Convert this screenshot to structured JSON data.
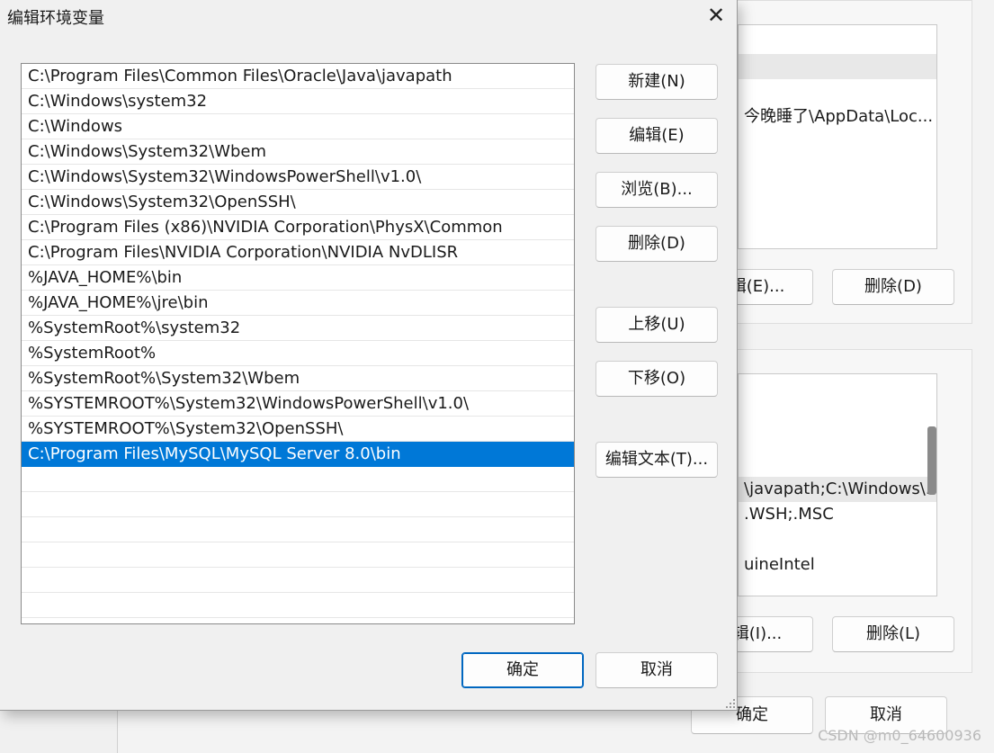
{
  "dialog": {
    "title": "编辑环境变量",
    "close_glyph": "✕",
    "paths": [
      "C:\\Program Files\\Common Files\\Oracle\\Java\\javapath",
      "C:\\Windows\\system32",
      "C:\\Windows",
      "C:\\Windows\\System32\\Wbem",
      "C:\\Windows\\System32\\WindowsPowerShell\\v1.0\\",
      "C:\\Windows\\System32\\OpenSSH\\",
      "C:\\Program Files (x86)\\NVIDIA Corporation\\PhysX\\Common",
      "C:\\Program Files\\NVIDIA Corporation\\NVIDIA NvDLISR",
      "%JAVA_HOME%\\bin",
      "%JAVA_HOME%\\jre\\bin",
      "%SystemRoot%\\system32",
      "%SystemRoot%",
      "%SystemRoot%\\System32\\Wbem",
      "%SYSTEMROOT%\\System32\\WindowsPowerShell\\v1.0\\",
      "%SYSTEMROOT%\\System32\\OpenSSH\\",
      "C:\\Program Files\\MySQL\\MySQL Server 8.0\\bin"
    ],
    "selected_path": "C:\\Program Files\\MySQL\\MySQL Server 8.0\\bin",
    "buttons": {
      "new": "新建(N)",
      "edit": "编辑(E)",
      "browse": "浏览(B)...",
      "delete": "删除(D)",
      "move_up": "上移(U)",
      "move_down": "下移(O)",
      "edit_text": "编辑文本(T)...",
      "ok": "确定",
      "cancel": "取消"
    }
  },
  "background_window": {
    "user_vars": {
      "visible_value": "今晚睡了\\AppData\\Loc...",
      "edit_button": "编辑(E)...",
      "delete_button": "删除(D)"
    },
    "system_vars": {
      "visible_values": [
        "\\javapath;C:\\Windows\\...",
        ".WSH;.MSC",
        "",
        "uineIntel"
      ],
      "edit_button": "编辑(I)...",
      "delete_button": "删除(L)"
    },
    "ok_button": "确定",
    "cancel_button": "取消"
  },
  "watermark": "CSDN @m0_64600936",
  "colors": {
    "selection": "#0078d7",
    "primary_border": "#0067c0"
  }
}
